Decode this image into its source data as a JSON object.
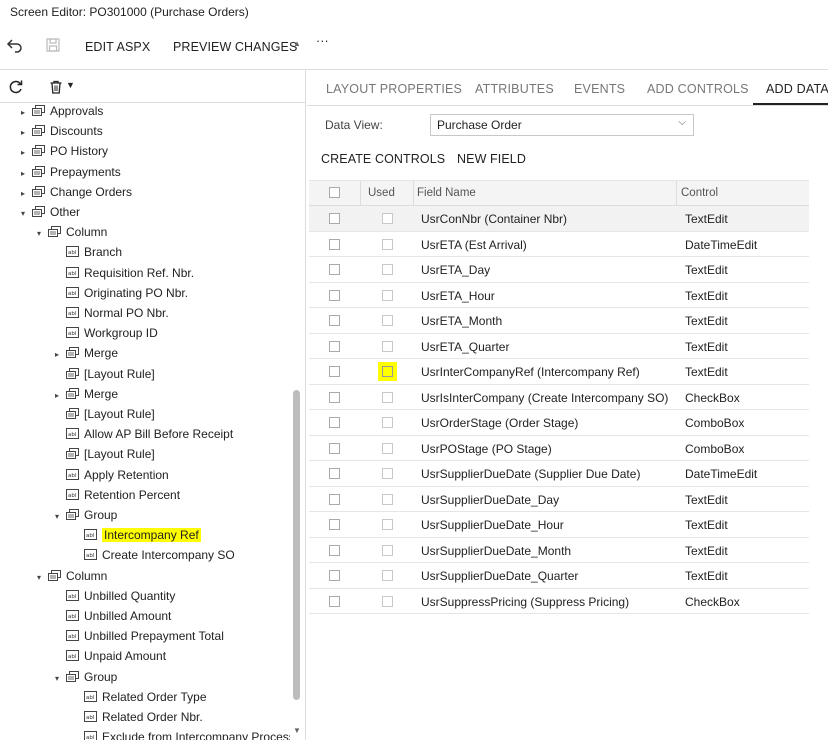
{
  "window": {
    "title": "Screen Editor: PO301000 (Purchase Orders)"
  },
  "toolbar": {
    "edit_aspx": "EDIT ASPX",
    "preview_changes": "PREVIEW CHANGES",
    "more": "···"
  },
  "tree": {
    "nodes": [
      {
        "label": "Approvals",
        "level": 1,
        "arrow": "right",
        "icon": "container"
      },
      {
        "label": "Discounts",
        "level": 1,
        "arrow": "right",
        "icon": "container"
      },
      {
        "label": "PO History",
        "level": 1,
        "arrow": "right",
        "icon": "container"
      },
      {
        "label": "Prepayments",
        "level": 1,
        "arrow": "right",
        "icon": "container"
      },
      {
        "label": "Change Orders",
        "level": 1,
        "arrow": "right",
        "icon": "container"
      },
      {
        "label": "Other",
        "level": 1,
        "arrow": "down",
        "icon": "container"
      },
      {
        "label": "Column",
        "level": 2,
        "arrow": "down",
        "icon": "container"
      },
      {
        "label": "Branch",
        "level": 3,
        "arrow": "",
        "icon": "field"
      },
      {
        "label": "Requisition Ref. Nbr.",
        "level": 3,
        "arrow": "",
        "icon": "field"
      },
      {
        "label": "Originating PO Nbr.",
        "level": 3,
        "arrow": "",
        "icon": "field"
      },
      {
        "label": "Normal PO Nbr.",
        "level": 3,
        "arrow": "",
        "icon": "field"
      },
      {
        "label": "Workgroup ID",
        "level": 3,
        "arrow": "",
        "icon": "field"
      },
      {
        "label": "Merge",
        "level": 3,
        "arrow": "right",
        "icon": "container"
      },
      {
        "label": "[Layout Rule]",
        "level": 3,
        "arrow": "",
        "icon": "container"
      },
      {
        "label": "Merge",
        "level": 3,
        "arrow": "right",
        "icon": "container"
      },
      {
        "label": "[Layout Rule]",
        "level": 3,
        "arrow": "",
        "icon": "container"
      },
      {
        "label": "Allow AP Bill Before Receipt",
        "level": 3,
        "arrow": "",
        "icon": "field"
      },
      {
        "label": "[Layout Rule]",
        "level": 3,
        "arrow": "",
        "icon": "container"
      },
      {
        "label": "Apply Retention",
        "level": 3,
        "arrow": "",
        "icon": "field"
      },
      {
        "label": "Retention Percent",
        "level": 3,
        "arrow": "",
        "icon": "field"
      },
      {
        "label": "Group",
        "level": 3,
        "arrow": "down",
        "icon": "container"
      },
      {
        "label": "Intercompany Ref",
        "level": 4,
        "arrow": "",
        "icon": "field",
        "highlight": true
      },
      {
        "label": "Create Intercompany SO",
        "level": 4,
        "arrow": "",
        "icon": "field"
      },
      {
        "label": "Column",
        "level": 2,
        "arrow": "down",
        "icon": "container"
      },
      {
        "label": "Unbilled Quantity",
        "level": 3,
        "arrow": "",
        "icon": "field"
      },
      {
        "label": "Unbilled Amount",
        "level": 3,
        "arrow": "",
        "icon": "field"
      },
      {
        "label": "Unbilled Prepayment Total",
        "level": 3,
        "arrow": "",
        "icon": "field"
      },
      {
        "label": "Unpaid Amount",
        "level": 3,
        "arrow": "",
        "icon": "field"
      },
      {
        "label": "Group",
        "level": 3,
        "arrow": "down",
        "icon": "container"
      },
      {
        "label": "Related Order Type",
        "level": 4,
        "arrow": "",
        "icon": "field"
      },
      {
        "label": "Related Order Nbr.",
        "level": 4,
        "arrow": "",
        "icon": "field"
      },
      {
        "label": "Exclude from Intercompany Processir",
        "level": 4,
        "arrow": "",
        "icon": "field"
      }
    ]
  },
  "tabs": [
    {
      "label": "LAYOUT PROPERTIES",
      "active": false
    },
    {
      "label": "ATTRIBUTES",
      "active": false
    },
    {
      "label": "EVENTS",
      "active": false
    },
    {
      "label": "ADD CONTROLS",
      "active": false
    },
    {
      "label": "ADD DATA F",
      "active": true
    }
  ],
  "data_view": {
    "label": "Data View:",
    "value": "Purchase Order"
  },
  "actions": {
    "create_controls": "CREATE CONTROLS",
    "new_field": "NEW FIELD"
  },
  "grid": {
    "columns": {
      "used": "Used",
      "field_name": "Field Name",
      "control": "Control"
    },
    "rows": [
      {
        "field": "UsrConNbr (Container Nbr)",
        "control": "TextEdit"
      },
      {
        "field": "UsrETA (Est Arrival)",
        "control": "DateTimeEdit"
      },
      {
        "field": "UsrETA_Day",
        "control": "TextEdit"
      },
      {
        "field": "UsrETA_Hour",
        "control": "TextEdit"
      },
      {
        "field": "UsrETA_Month",
        "control": "TextEdit"
      },
      {
        "field": "UsrETA_Quarter",
        "control": "TextEdit"
      },
      {
        "field": "UsrInterCompanyRef (Intercompany Ref)",
        "control": "TextEdit",
        "used_highlight": true
      },
      {
        "field": "UsrIsInterCompany (Create Intercompany SO)",
        "control": "CheckBox"
      },
      {
        "field": "UsrOrderStage (Order Stage)",
        "control": "ComboBox"
      },
      {
        "field": "UsrPOStage (PO Stage)",
        "control": "ComboBox"
      },
      {
        "field": "UsrSupplierDueDate (Supplier Due Date)",
        "control": "DateTimeEdit"
      },
      {
        "field": "UsrSupplierDueDate_Day",
        "control": "TextEdit"
      },
      {
        "field": "UsrSupplierDueDate_Hour",
        "control": "TextEdit"
      },
      {
        "field": "UsrSupplierDueDate_Month",
        "control": "TextEdit"
      },
      {
        "field": "UsrSupplierDueDate_Quarter",
        "control": "TextEdit"
      },
      {
        "field": "UsrSuppressPricing (Suppress Pricing)",
        "control": "CheckBox"
      }
    ]
  },
  "colors": {
    "highlight": "#ffff00",
    "border": "#dcdcdc",
    "header_bg": "#f4f4f4"
  }
}
